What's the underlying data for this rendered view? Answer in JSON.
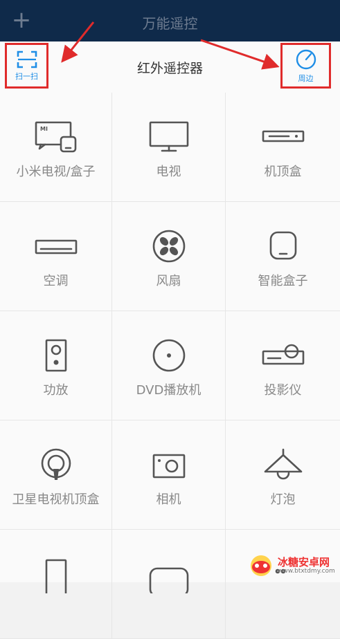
{
  "topbar": {
    "title": "万能遥控",
    "add_icon": "plus-icon"
  },
  "header": {
    "title": "红外遥控器",
    "scan_label": "扫一扫",
    "nearby_label": "周边",
    "accent_color": "#1f8ee6",
    "highlight_color": "#e02b2b"
  },
  "devices": [
    {
      "label": "小米电视/盒子",
      "icon": "mi-tv-box-icon"
    },
    {
      "label": "电视",
      "icon": "tv-icon"
    },
    {
      "label": "机顶盒",
      "icon": "set-top-box-icon"
    },
    {
      "label": "空调",
      "icon": "air-conditioner-icon"
    },
    {
      "label": "风扇",
      "icon": "fan-icon"
    },
    {
      "label": "智能盒子",
      "icon": "smart-box-icon"
    },
    {
      "label": "功放",
      "icon": "speaker-icon"
    },
    {
      "label": "DVD播放机",
      "icon": "dvd-icon"
    },
    {
      "label": "投影仪",
      "icon": "projector-icon"
    },
    {
      "label": "卫星电视机顶盒",
      "icon": "satellite-icon"
    },
    {
      "label": "相机",
      "icon": "camera-icon"
    },
    {
      "label": "灯泡",
      "icon": "lamp-icon"
    },
    {
      "label": "",
      "icon": "tablet-icon"
    },
    {
      "label": "",
      "icon": "rounded-device-icon"
    },
    {
      "label": "",
      "icon": "more-icon"
    }
  ],
  "watermark": {
    "name": "冰糖安卓网",
    "url": "www.btxtdmy.com"
  }
}
